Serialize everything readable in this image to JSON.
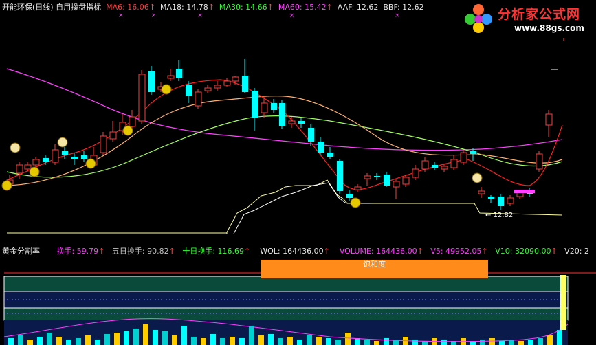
{
  "header": {
    "stock_title": "开能环保(日线)",
    "indicator_name": "自用操盘指标",
    "ma6": {
      "label": "MA6: 16.06",
      "color": "#ff3b3b"
    },
    "ma18": {
      "label": "MA18: 14.78",
      "color": "#ffffff"
    },
    "ma30": {
      "label": "MA30: 14.66",
      "color": "#33ff33"
    },
    "ma60": {
      "label": "MA60: 15.42",
      "color": "#ff40ff"
    },
    "aaf": {
      "label": "AAF: 12.62",
      "color": "#ffffff"
    },
    "bbf": {
      "label": "BBF: 12.62",
      "color": "#ffffff"
    }
  },
  "logo": {
    "brand": "分析家公式网",
    "url": "www.88gs.com",
    "icon": "flower-logo-icon"
  },
  "chart_annotation": {
    "low_price_label": "12.82"
  },
  "sub_header": {
    "indicator_name": "黄金分割率",
    "turnover": "换手: 59.79",
    "turnover5": "五日换手: 90.82",
    "turnover10": "十日换手: 116.69",
    "wol": "WOL: 164436.00",
    "volume": "VOLUME: 164436.00",
    "v5": "V5: 49952.05",
    "v10": "V10: 32090.00",
    "v20": "V20: 2"
  },
  "saturation_label": "饱和度",
  "colors": {
    "up_candle": "#ff3b3b",
    "down_candle": "#00ffff",
    "ma6": "#ff2020",
    "ma18": "#ffb070",
    "ma30": "#a0ff60",
    "ma60": "#ff40ff",
    "aaf": "#ffffff",
    "bbf": "#ffffa0",
    "sub_bg": "#0a4a3a",
    "grid": "#ffffff"
  }
}
